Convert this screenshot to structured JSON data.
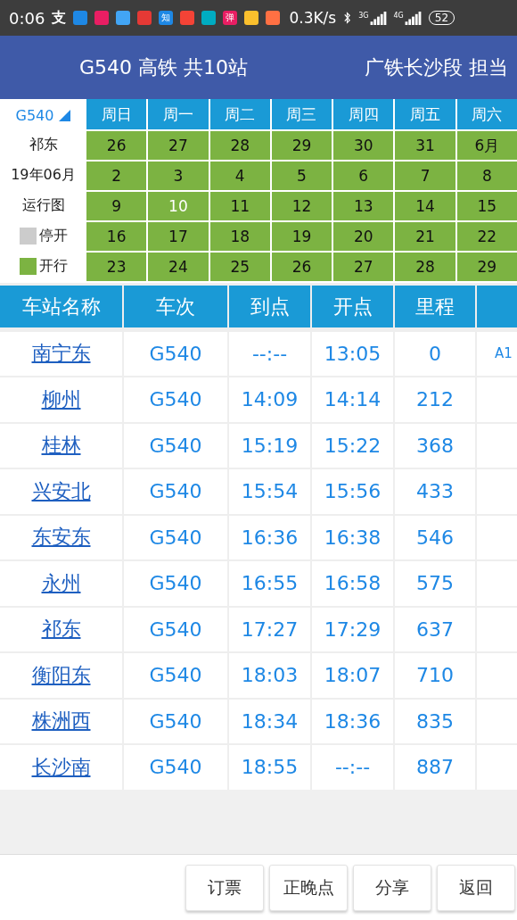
{
  "status_bar": {
    "time": "0:06",
    "icons": [
      {
        "kind": "glyph",
        "text": "支"
      },
      {
        "kind": "app",
        "color": "#1e88e5"
      },
      {
        "kind": "app",
        "color": "#e91e63"
      },
      {
        "kind": "app",
        "color": "#42a5f5"
      },
      {
        "kind": "app",
        "color": "#e53935"
      },
      {
        "kind": "badge",
        "color": "#1e88e5",
        "text": "知"
      },
      {
        "kind": "app",
        "color": "#f44336"
      },
      {
        "kind": "app",
        "color": "#00acc1"
      },
      {
        "kind": "badge",
        "color": "#e91e63",
        "text": "弹"
      },
      {
        "kind": "app",
        "color": "#fbc02d"
      },
      {
        "kind": "app",
        "color": "#ff7043"
      }
    ],
    "speed": "0.3K/s",
    "sim1": "3G",
    "sim2": "4G",
    "battery": "52"
  },
  "header": {
    "title": "G540 高铁 共10站",
    "operator": "广铁长沙段 担当"
  },
  "calendar": {
    "train": "G540",
    "station": "祁东",
    "month": "19年06月",
    "caption": "运行图",
    "legend": [
      {
        "label": "停开",
        "color": "#cccccc"
      },
      {
        "label": "开行",
        "color": "#7cb342"
      }
    ],
    "weekdays": [
      "周日",
      "周一",
      "周二",
      "周三",
      "周四",
      "周五",
      "周六"
    ],
    "weeks": [
      [
        {
          "day": "26",
          "running": true,
          "today": false
        },
        {
          "day": "27",
          "running": true,
          "today": false
        },
        {
          "day": "28",
          "running": true,
          "today": false
        },
        {
          "day": "29",
          "running": true,
          "today": false
        },
        {
          "day": "30",
          "running": true,
          "today": false
        },
        {
          "day": "31",
          "running": true,
          "today": false
        },
        {
          "day": "6月",
          "running": true,
          "today": false
        }
      ],
      [
        {
          "day": "2",
          "running": true,
          "today": false
        },
        {
          "day": "3",
          "running": true,
          "today": false
        },
        {
          "day": "4",
          "running": true,
          "today": false
        },
        {
          "day": "5",
          "running": true,
          "today": false
        },
        {
          "day": "6",
          "running": true,
          "today": false
        },
        {
          "day": "7",
          "running": true,
          "today": false
        },
        {
          "day": "8",
          "running": true,
          "today": false
        }
      ],
      [
        {
          "day": "9",
          "running": true,
          "today": false
        },
        {
          "day": "10",
          "running": true,
          "today": true
        },
        {
          "day": "11",
          "running": true,
          "today": false
        },
        {
          "day": "12",
          "running": true,
          "today": false
        },
        {
          "day": "13",
          "running": true,
          "today": false
        },
        {
          "day": "14",
          "running": true,
          "today": false
        },
        {
          "day": "15",
          "running": true,
          "today": false
        }
      ],
      [
        {
          "day": "16",
          "running": true,
          "today": false
        },
        {
          "day": "17",
          "running": true,
          "today": false
        },
        {
          "day": "18",
          "running": true,
          "today": false
        },
        {
          "day": "19",
          "running": true,
          "today": false
        },
        {
          "day": "20",
          "running": true,
          "today": false
        },
        {
          "day": "21",
          "running": true,
          "today": false
        },
        {
          "day": "22",
          "running": true,
          "today": false
        }
      ],
      [
        {
          "day": "23",
          "running": true,
          "today": false
        },
        {
          "day": "24",
          "running": true,
          "today": false
        },
        {
          "day": "25",
          "running": true,
          "today": false
        },
        {
          "day": "26",
          "running": true,
          "today": false
        },
        {
          "day": "27",
          "running": true,
          "today": false
        },
        {
          "day": "28",
          "running": true,
          "today": false
        },
        {
          "day": "29",
          "running": true,
          "today": false
        }
      ]
    ]
  },
  "table": {
    "columns": [
      "车站名称",
      "车次",
      "到点",
      "开点",
      "里程"
    ],
    "rows": [
      [
        "南宁东",
        "G540",
        "--:--",
        "13:05",
        "0",
        "A1"
      ],
      [
        "柳州",
        "G540",
        "14:09",
        "14:14",
        "212",
        ""
      ],
      [
        "桂林",
        "G540",
        "15:19",
        "15:22",
        "368",
        ""
      ],
      [
        "兴安北",
        "G540",
        "15:54",
        "15:56",
        "433",
        ""
      ],
      [
        "东安东",
        "G540",
        "16:36",
        "16:38",
        "546",
        ""
      ],
      [
        "永州",
        "G540",
        "16:55",
        "16:58",
        "575",
        ""
      ],
      [
        "祁东",
        "G540",
        "17:27",
        "17:29",
        "637",
        ""
      ],
      [
        "衡阳东",
        "G540",
        "18:03",
        "18:07",
        "710",
        ""
      ],
      [
        "株洲西",
        "G540",
        "18:34",
        "18:36",
        "835",
        ""
      ],
      [
        "长沙南",
        "G540",
        "18:55",
        "--:--",
        "887",
        ""
      ]
    ]
  },
  "buttons": [
    "订票",
    "正晚点",
    "分享",
    "返回"
  ]
}
